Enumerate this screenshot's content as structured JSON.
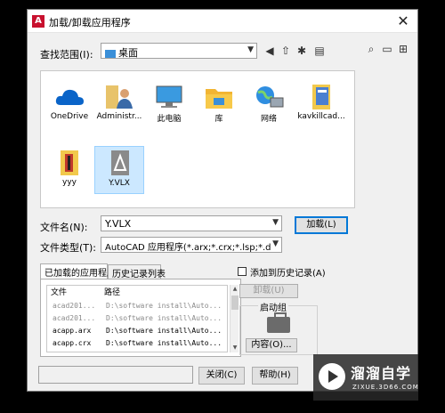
{
  "window": {
    "title": "加载/卸载应用程序",
    "close_glyph": "✕"
  },
  "lookin": {
    "label": "查找范围(I):",
    "value": "桌面"
  },
  "files": [
    {
      "name": "OneDrive",
      "icon": "cloud-icon"
    },
    {
      "name": "Administr...",
      "icon": "user-folder-icon"
    },
    {
      "name": "此电脑",
      "icon": "computer-icon"
    },
    {
      "name": "库",
      "icon": "library-folder-icon"
    },
    {
      "name": "网络",
      "icon": "network-icon"
    },
    {
      "name": "kavkillcad...",
      "icon": "document-folder-icon"
    },
    {
      "name": "yyy",
      "icon": "folder-icon"
    },
    {
      "name": "Y.VLX",
      "icon": "autocad-file-icon"
    }
  ],
  "filename": {
    "label": "文件名(N):",
    "value": "Y.VLX"
  },
  "filetype": {
    "label": "文件类型(T):",
    "value": "AutoCAD 应用程序(*.arx;*.crx;*.lsp;*.dvb;*.dbx"
  },
  "buttons": {
    "load": "加载(L)",
    "unload": "卸载(U)",
    "contents": "内容(O)...",
    "close": "关闭(C)",
    "help": "帮助(H)"
  },
  "tabs": {
    "loaded": "已加载的应用程序",
    "history": "历史记录列表"
  },
  "list": {
    "col_file": "文件",
    "col_path": "路径",
    "rows": [
      {
        "file": "acad201...",
        "path": "D:\\software install\\Auto...",
        "dim": true
      },
      {
        "file": "acad201...",
        "path": "D:\\software install\\Auto...",
        "dim": true
      },
      {
        "file": "acapp.arx",
        "path": "D:\\software install\\Auto...",
        "dim": false
      },
      {
        "file": "acapp.crx",
        "path": "D:\\software install\\Auto...",
        "dim": false
      }
    ]
  },
  "history_checkbox": "添加到历史记录(A)",
  "startup_group": "启动组",
  "watermark": {
    "title": "溜溜自学",
    "sub": "ZIXUE.3D66.COM"
  }
}
